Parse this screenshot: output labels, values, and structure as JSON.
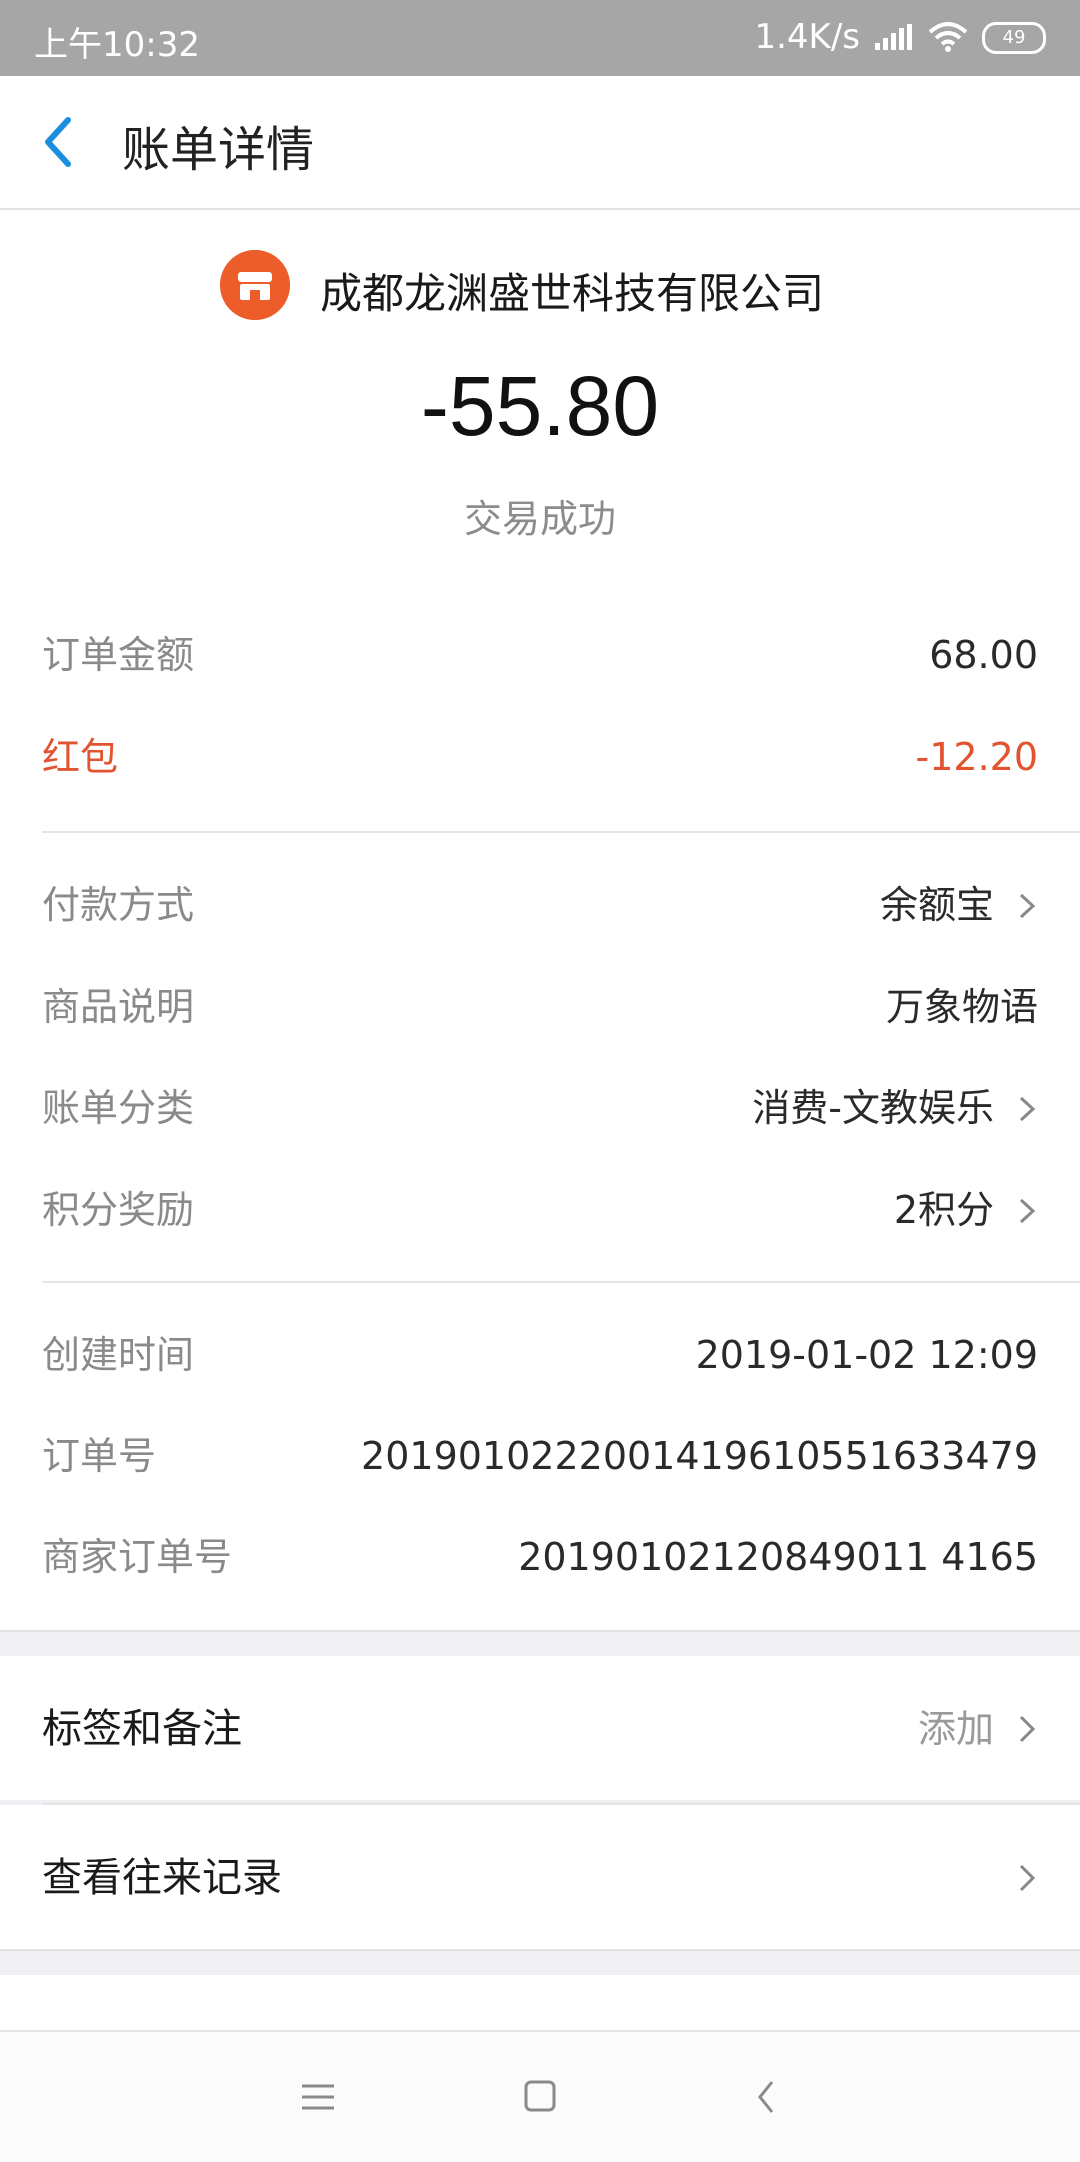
{
  "status_bar": {
    "time": "上午10:32",
    "network_speed": "1.4K/s",
    "battery": "49"
  },
  "header": {
    "title": "账单详情"
  },
  "merchant": {
    "name": "成都龙渊盛世科技有限公司",
    "amount": "-55.80",
    "status": "交易成功"
  },
  "summary": [
    {
      "label": "订单金额",
      "value": "68.00"
    },
    {
      "label": "红包",
      "value": "-12.20"
    }
  ],
  "details": [
    {
      "label": "付款方式",
      "value": "余额宝"
    },
    {
      "label": "商品说明",
      "value": "万象物语"
    },
    {
      "label": "账单分类",
      "value": "消费-文教娱乐"
    },
    {
      "label": "积分奖励",
      "value": "2积分"
    }
  ],
  "meta": [
    {
      "label": "创建时间",
      "value": "2019-01-02 12:09"
    },
    {
      "label": "订单号",
      "value": "2019010222001419610551633479"
    },
    {
      "label": "商家订单号",
      "value": "20190102120849011 4165"
    }
  ],
  "actions": [
    {
      "label": "标签和备注",
      "value": "添加"
    },
    {
      "label": "查看往来记录",
      "value": ""
    }
  ],
  "colors": {
    "accent_blue": "#1a8fe0",
    "red": "#e2542f",
    "merchant_logo": "#ec5d29"
  }
}
